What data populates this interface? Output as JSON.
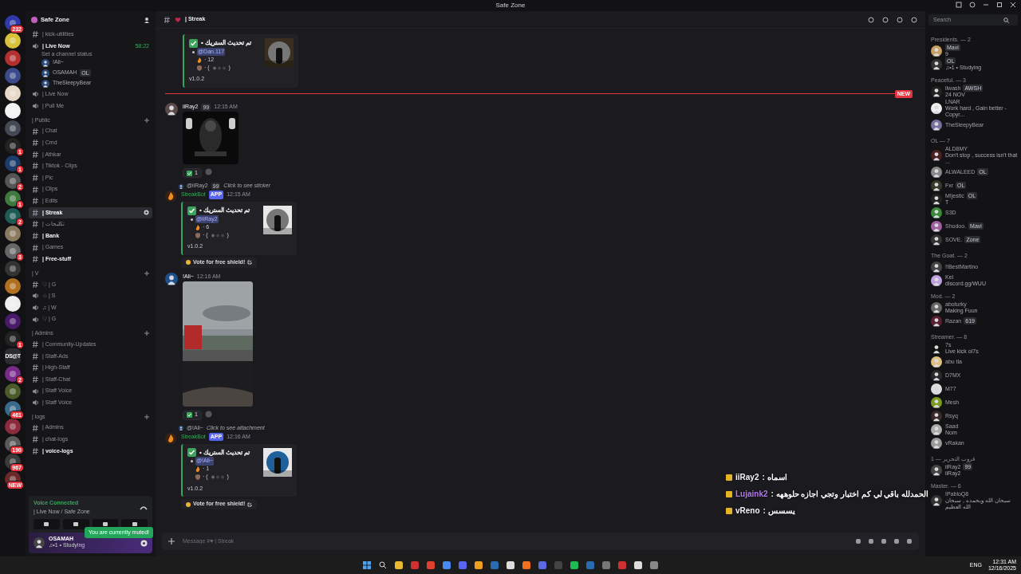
{
  "title_bar": {
    "title": "Safe Zone"
  },
  "servers": [
    {
      "kind": "icon",
      "badge": "232"
    },
    {
      "kind": "icon"
    },
    {
      "kind": "icon"
    },
    {
      "kind": "icon"
    },
    {
      "kind": "icon"
    },
    {
      "kind": "icon"
    },
    {
      "kind": "icon"
    },
    {
      "kind": "icon",
      "badge": "1"
    },
    {
      "kind": "icon",
      "badge": "1"
    },
    {
      "kind": "icon",
      "badge": "2"
    },
    {
      "kind": "icon",
      "badge": "1"
    },
    {
      "kind": "icon",
      "badge": "2"
    },
    {
      "kind": "icon"
    },
    {
      "kind": "icon",
      "badge": "3"
    },
    {
      "kind": "icon"
    },
    {
      "kind": "icon"
    },
    {
      "kind": "icon"
    },
    {
      "kind": "icon"
    },
    {
      "kind": "icon",
      "badge": "1"
    },
    {
      "kind": "text",
      "label": "DS@T"
    },
    {
      "kind": "icon",
      "badge": "2"
    },
    {
      "kind": "icon"
    },
    {
      "kind": "icon",
      "badge": "461"
    },
    {
      "kind": "icon"
    },
    {
      "kind": "icon",
      "badge": "190"
    },
    {
      "kind": "icon",
      "badge": "967"
    },
    {
      "kind": "icon",
      "badge": "NEW"
    }
  ],
  "server_name": "Safe Zone",
  "channels": [
    {
      "kind": "text",
      "name": "| kick-utilities",
      "selected": false,
      "unread": false
    },
    {
      "kind": "voice",
      "name": "| Live Now",
      "selected": false,
      "unread": true,
      "timer": "58:22",
      "status": "Set a channel status",
      "children": [
        {
          "name": "!Ali~"
        },
        {
          "name": "OSAMAH",
          "tag": "OL"
        },
        {
          "name": "TheSleepyBear"
        }
      ]
    },
    {
      "kind": "voice",
      "name": "| Live Now",
      "selected": false,
      "unread": false
    },
    {
      "kind": "voice",
      "name": "| Pull Me",
      "selected": false,
      "unread": false
    },
    {
      "kind": "category",
      "name": "| Public"
    },
    {
      "kind": "text",
      "name": "| Chat",
      "selected": false,
      "unread": false
    },
    {
      "kind": "text",
      "name": "| Cmd",
      "selected": false,
      "unread": false
    },
    {
      "kind": "text",
      "name": "| Athkar",
      "selected": false,
      "unread": false
    },
    {
      "kind": "text",
      "name": "| Tiktok - Clips",
      "selected": false,
      "unread": false
    },
    {
      "kind": "text",
      "name": "| Pic",
      "selected": false,
      "unread": false
    },
    {
      "kind": "text",
      "name": "| Clips",
      "selected": false,
      "unread": false
    },
    {
      "kind": "text",
      "name": "| Edits",
      "selected": false,
      "unread": false
    },
    {
      "kind": "text",
      "name": "| Streak",
      "selected": true,
      "unread": false
    },
    {
      "kind": "text",
      "name": "| تكليجات",
      "selected": false,
      "unread": false
    },
    {
      "kind": "text",
      "name": "| Bank",
      "selected": false,
      "unread": true
    },
    {
      "kind": "text",
      "name": "| Games",
      "selected": false,
      "unread": false
    },
    {
      "kind": "text",
      "name": "| Free-stuff",
      "selected": false,
      "unread": true
    },
    {
      "kind": "category",
      "name": "| V"
    },
    {
      "kind": "text",
      "name": "♡ | G",
      "selected": false,
      "unread": false
    },
    {
      "kind": "voice",
      "name": "☆ | S",
      "selected": false,
      "unread": false
    },
    {
      "kind": "voice",
      "name": "♫ | W",
      "selected": false,
      "unread": false
    },
    {
      "kind": "voice",
      "name": "♡ | G",
      "selected": false,
      "unread": false
    },
    {
      "kind": "category",
      "name": "| Admins"
    },
    {
      "kind": "text",
      "name": "| Community-Updates",
      "selected": false,
      "unread": false
    },
    {
      "kind": "text",
      "name": "| Staff-Ads",
      "selected": false,
      "unread": false
    },
    {
      "kind": "text",
      "name": "| High-Staff",
      "selected": false,
      "unread": false
    },
    {
      "kind": "text",
      "name": "| Staff-Chat",
      "selected": false,
      "unread": false
    },
    {
      "kind": "voice",
      "name": "| Staff Voice",
      "selected": false,
      "unread": false
    },
    {
      "kind": "voice",
      "name": "| Staff Voice",
      "selected": false,
      "unread": false
    },
    {
      "kind": "category",
      "name": "| logs"
    },
    {
      "kind": "text",
      "name": "| Admins",
      "selected": false,
      "unread": false
    },
    {
      "kind": "text",
      "name": "| chat-logs",
      "selected": false,
      "unread": false
    },
    {
      "kind": "text",
      "name": "| voice-logs",
      "selected": false,
      "unread": true
    }
  ],
  "voice_panel": {
    "title": "Voice Connected",
    "location": "| Live Now / Safe Zone",
    "tooltip": "You are currently muted!"
  },
  "user_panel": {
    "name": "OSAMAH",
    "status": "♫•1 • Studying"
  },
  "chat": {
    "channel": "| Streak",
    "composer_placeholder": "Message #♥ | Streak",
    "messages": [
      {
        "kind": "embed",
        "embed": {
          "title": "تم تحديث الستريك •",
          "mention": "@Dan.117",
          "count": "· 12",
          "shields": "· (",
          "shields_end": ")",
          "version": "v1.0.2"
        }
      },
      {
        "kind": "divider",
        "label": "NEW"
      },
      {
        "author": "iiRay2",
        "tag": "99",
        "time": "12:15 AM",
        "reaction": "1"
      },
      {
        "kind": "bot",
        "reply": {
          "user": "@iiRay2",
          "tag": "99",
          "text": "Click to see sticker"
        },
        "author": "StreakBot",
        "badge": "APP",
        "time": "12:15 AM",
        "embed": {
          "title": "تم تحديث الستريك •",
          "mention": "@iiRay2",
          "count": "· 6",
          "shields": "· (",
          "shields_end": ")",
          "version": "v1.0.2"
        },
        "button": "Vote for free shield!"
      },
      {
        "kind": "video",
        "author": "!Ali~",
        "time": "12:16 AM",
        "reaction": "1"
      },
      {
        "kind": "bot",
        "reply": {
          "user": "@!Ali~",
          "text": "Click to see attachment"
        },
        "author": "StreakBot",
        "badge": "APP",
        "time": "12:16 AM",
        "embed": {
          "title": "تم تحديث الستريك •",
          "mention": "@!Ali~",
          "count": "· 1",
          "shields": "· (",
          "shields_end": ")",
          "version": "v1.0.2"
        },
        "button": "Vote for free shield!"
      }
    ]
  },
  "overlay_chat": [
    {
      "name": "iiRay2",
      "text": ": اسماه",
      "color": "#f5f5f5"
    },
    {
      "name": "Lujaink2",
      "text": ": الحمدلله باقي لي كم اختبار وتجي اجازه حلوههه",
      "color": "#b57be8"
    },
    {
      "name": "vReno",
      "text": ": يسسس",
      "color": "#f5f5f5"
    }
  ],
  "members": {
    "search_placeholder": "Search",
    "groups": [
      {
        "title": "Presidents. — 2",
        "members": [
          {
            "tag": "Mavi",
            "status": "9"
          },
          {
            "tag": "OL",
            "status": "♫•1 • Studying"
          }
        ]
      },
      {
        "title": "Peaceful. — 3",
        "members": [
          {
            "name": "llwash",
            "tag": "AWSH",
            "status": "24 NOV"
          },
          {
            "name": "LNAR",
            "status": "Work hard , Gain better - Copyr..."
          },
          {
            "name": "TheSleepyBear"
          }
        ]
      },
      {
        "title": "OL — 7",
        "members": [
          {
            "name": "ALD8MY",
            "status": "Don't stop , success isn't that ..."
          },
          {
            "name": "ALWALEED",
            "tag": "OL"
          },
          {
            "name": "Fxr",
            "tag": "OL"
          },
          {
            "name": "M!jestic",
            "tag": "OL",
            "status": "T"
          },
          {
            "name": "S3D"
          },
          {
            "name": "Shodoo.",
            "tag": "Mavi"
          },
          {
            "name": "SOVE.",
            "tag": "Zone"
          }
        ]
      },
      {
        "title": "The Goat. — 2",
        "members": [
          {
            "name": "!!BestMartino"
          },
          {
            "name": "Kel",
            "status": "discord.gg/WUU"
          }
        ]
      },
      {
        "title": "Mod. — 2",
        "members": [
          {
            "name": "aboturky",
            "status": "Making Fuun"
          },
          {
            "name": "Razan",
            "tag": "619"
          }
        ]
      },
      {
        "title": "Streamer. — 8",
        "members": [
          {
            "name": "7s",
            "status": "Live kick ol7s"
          },
          {
            "name": "abu tla"
          },
          {
            "name": "D7MX"
          },
          {
            "name": "M77"
          },
          {
            "name": "Mesh"
          },
          {
            "name": "Rsyq"
          },
          {
            "name": "Saad",
            "status": "Nom"
          },
          {
            "name": "vRakan"
          }
        ]
      },
      {
        "title": "قروب التحرير — 1",
        "members": [
          {
            "name": "iiRay2",
            "tag": "99",
            "status": "iiRay2"
          }
        ]
      },
      {
        "title": "Master. — 6",
        "members": [
          {
            "name": "!PabloQ8",
            "status": "سبحان الله وبحمده , سبحان الله العظيم"
          }
        ]
      }
    ]
  },
  "taskbar": {
    "language": "ENG",
    "time": "12:31 AM",
    "date": "12/16/2025"
  }
}
